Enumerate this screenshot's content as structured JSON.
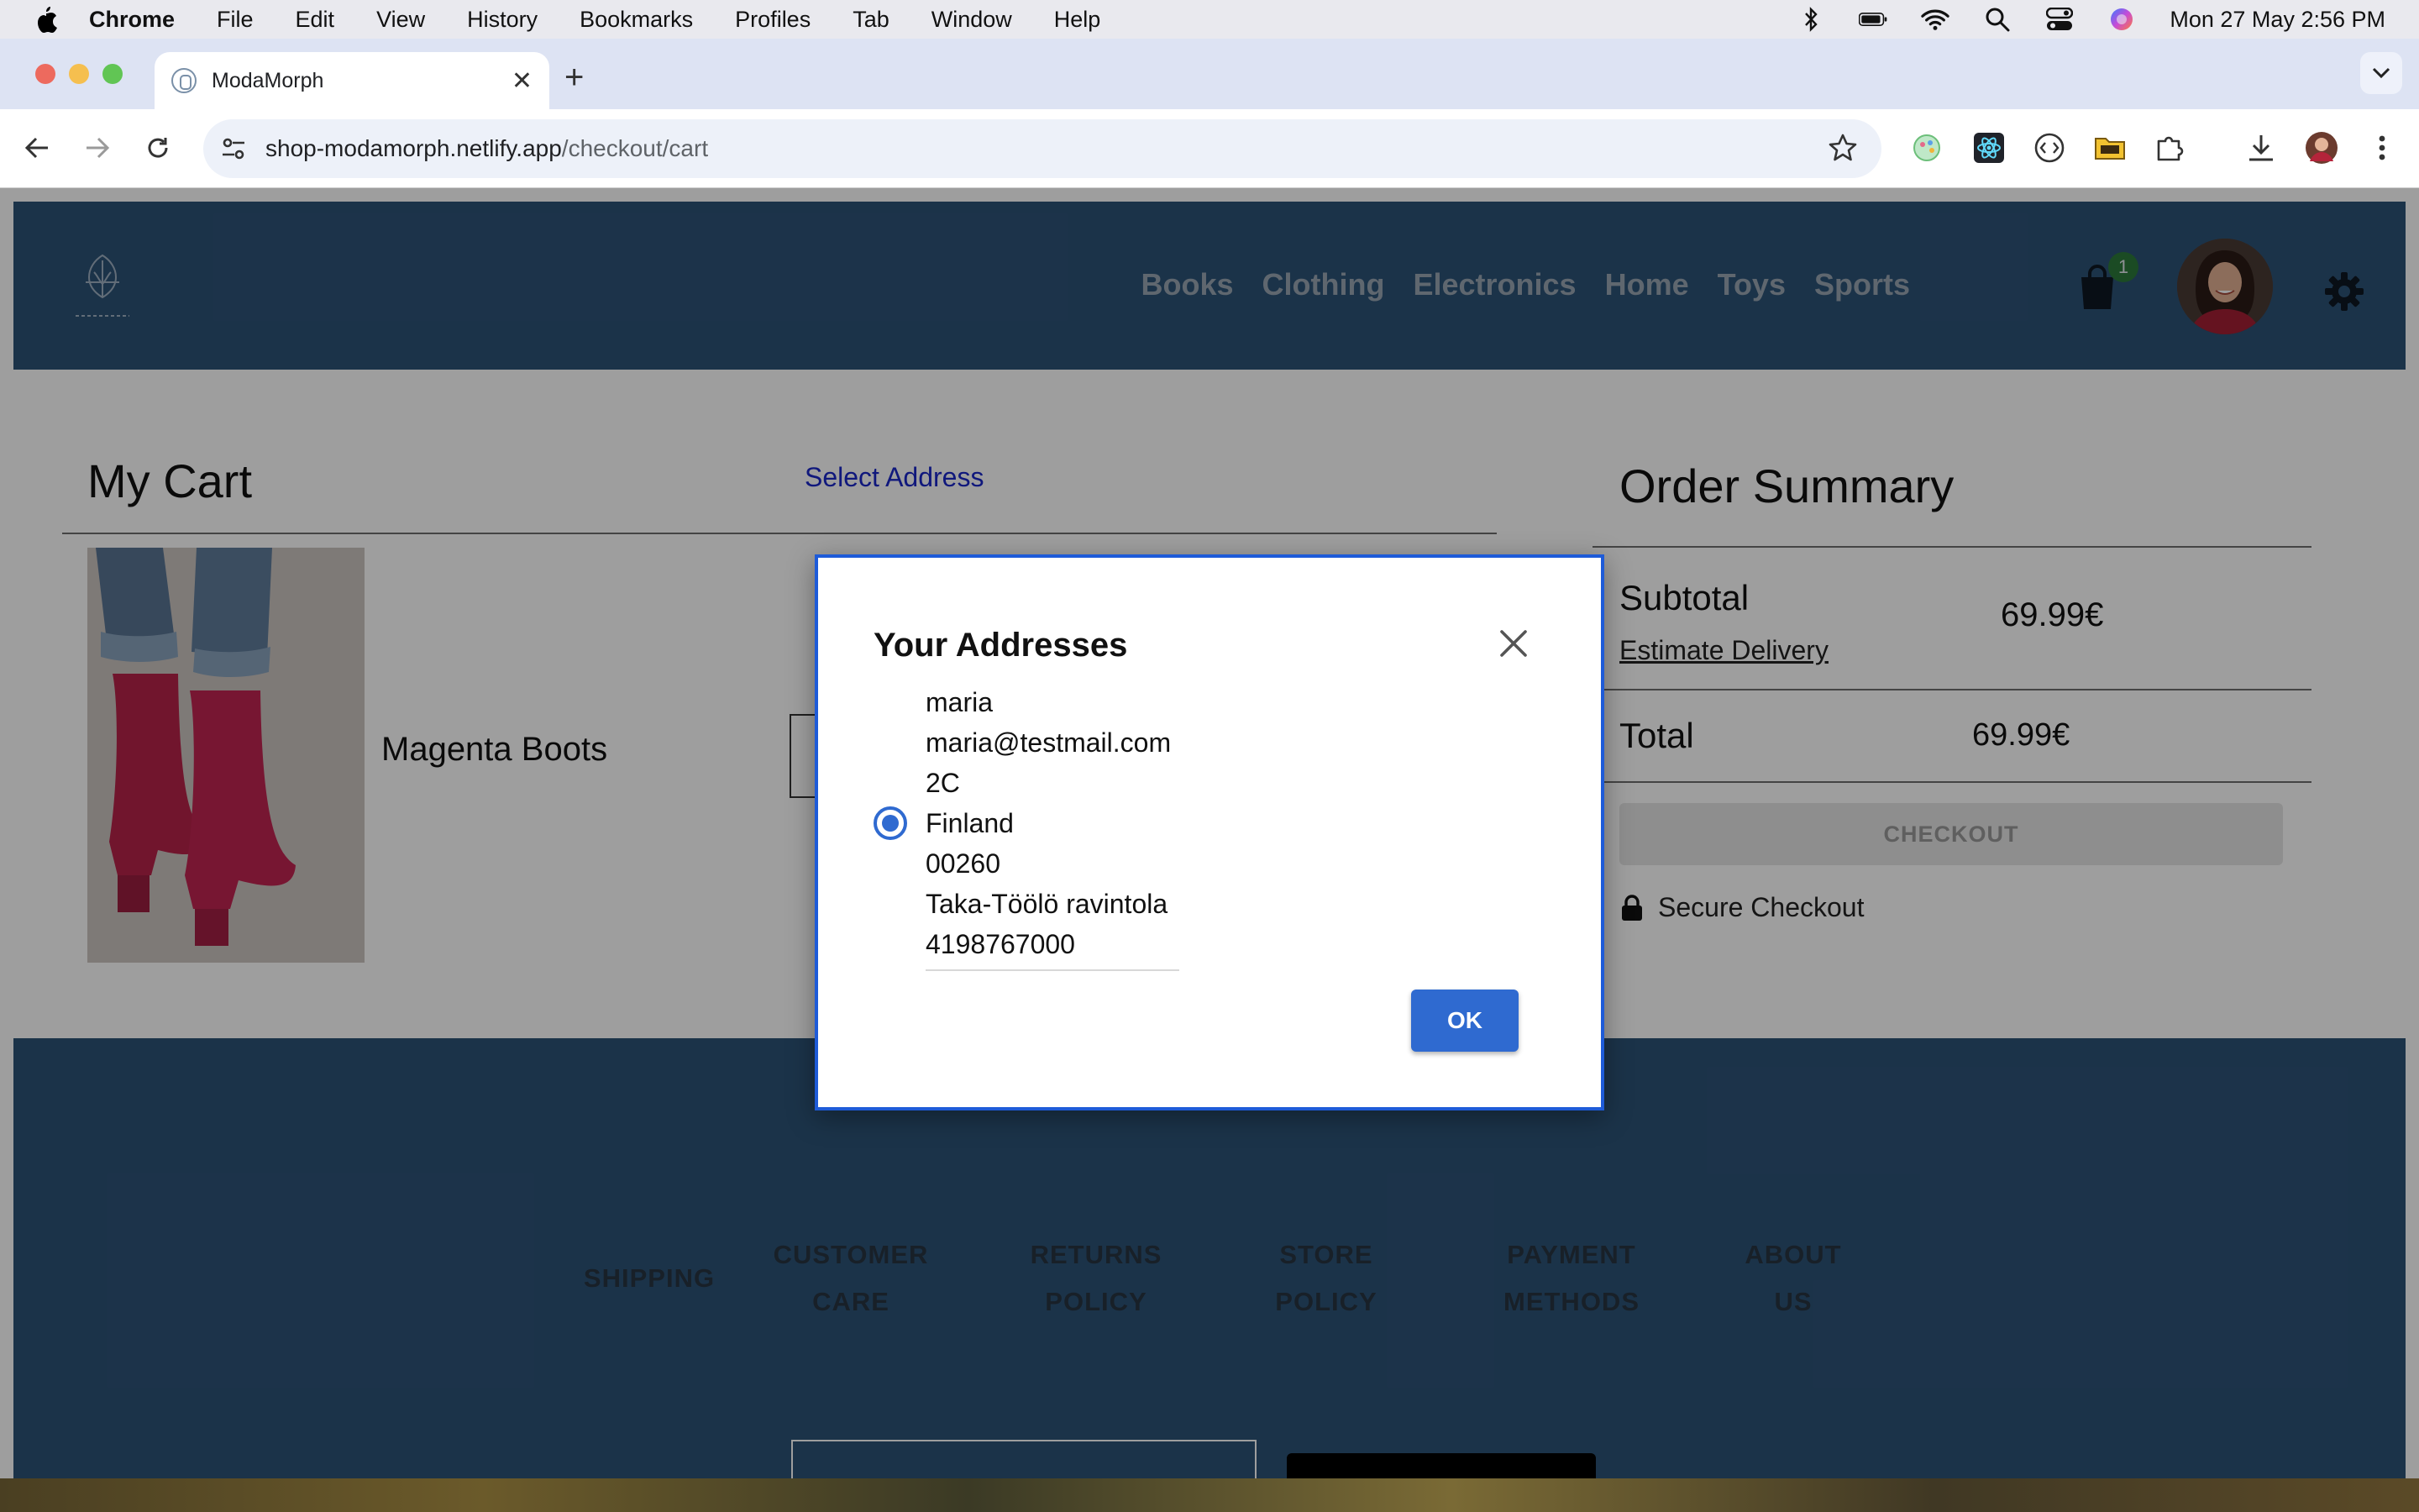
{
  "menubar": {
    "items": [
      "Chrome",
      "File",
      "Edit",
      "View",
      "History",
      "Bookmarks",
      "Profiles",
      "Tab",
      "Window",
      "Help"
    ],
    "datetime": "Mon 27 May  2:56 PM"
  },
  "browser": {
    "tab_title": "ModaMorph",
    "url_host": "shop-modamorph.netlify.app",
    "url_path": "/checkout/cart"
  },
  "site": {
    "nav": [
      "Books",
      "Clothing",
      "Electronics",
      "Home",
      "Toys",
      "Sports"
    ],
    "cart_count": "1",
    "brand_color": "#2d5377"
  },
  "cart": {
    "title": "My Cart",
    "select_address": "Select Address",
    "product_name": "Magenta Boots"
  },
  "summary": {
    "title": "Order Summary",
    "subtotal_label": "Subtotal",
    "subtotal_value": "69.99€",
    "estimate_delivery": "Estimate Delivery",
    "total_label": "Total",
    "total_value": "69.99€",
    "checkout_label": "CHECKOUT",
    "secure_label": "Secure Checkout"
  },
  "footer": {
    "links": [
      [
        "SHIPPING"
      ],
      [
        "CUSTOMER",
        "CARE"
      ],
      [
        "RETURNS",
        "POLICY"
      ],
      [
        "STORE",
        "POLICY"
      ],
      [
        "PAYMENT",
        "METHODS"
      ],
      [
        "ABOUT",
        "US"
      ]
    ]
  },
  "dialog": {
    "title": "Your Addresses",
    "address": {
      "name": "maria",
      "email": "maria@testmail.com",
      "street": "2C",
      "country": "Finland",
      "postal_code": "00260",
      "place": "Taka-Töölö ravintola",
      "phone": "4198767000"
    },
    "selected": true,
    "ok_label": "OK",
    "accent_color": "#2f6ad0"
  }
}
